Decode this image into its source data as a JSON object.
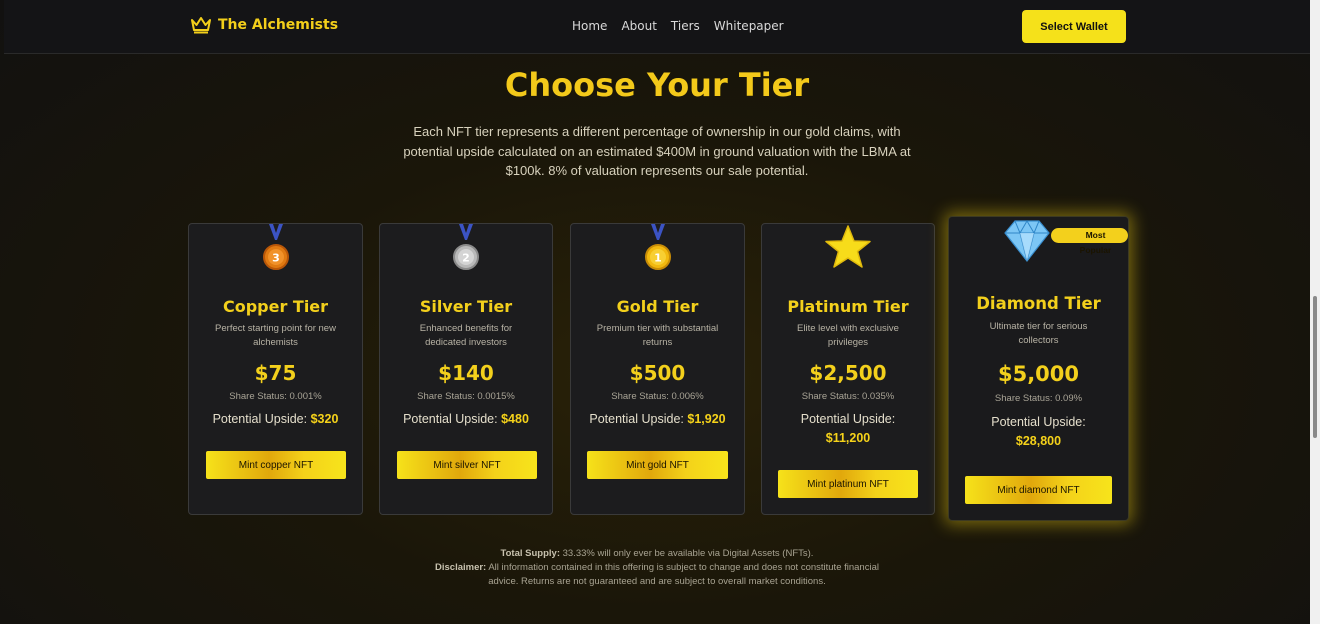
{
  "brand": {
    "name": "The Alchemists",
    "icon": "crown-icon"
  },
  "nav": {
    "links": [
      "Home",
      "About",
      "Tiers",
      "Whitepaper"
    ],
    "wallet_label": "Select Wallet"
  },
  "header": {
    "title": "Choose Your Tier",
    "subtitle": "Each NFT tier represents a different percentage of ownership in our gold claims, with potential upside calculated on an estimated $400M in ground valuation with the LBMA at $100k. 8% of valuation represents our sale potential."
  },
  "tiers": [
    {
      "name": "Copper Tier",
      "icon": "bronze-medal-icon",
      "desc": "Perfect starting point for new alchemists",
      "price": "$75",
      "share": "Share Status: 0.001%",
      "upside_label": "Potential Upside:",
      "upside_value": "$320",
      "button": "Mint copper NFT"
    },
    {
      "name": "Silver Tier",
      "icon": "silver-medal-icon",
      "desc": "Enhanced benefits for dedicated investors",
      "price": "$140",
      "share": "Share Status: 0.0015%",
      "upside_label": "Potential Upside:",
      "upside_value": "$480",
      "button": "Mint silver NFT"
    },
    {
      "name": "Gold Tier",
      "icon": "gold-medal-icon",
      "desc": "Premium tier with substantial returns",
      "price": "$500",
      "share": "Share Status: 0.006%",
      "upside_label": "Potential Upside:",
      "upside_value": "$1,920",
      "button": "Mint gold NFT"
    },
    {
      "name": "Platinum Tier",
      "icon": "star-icon",
      "desc": "Elite level with exclusive privileges",
      "price": "$2,500",
      "share": "Share Status: 0.035%",
      "upside_label": "Potential Upside:",
      "upside_value": "$11,200",
      "button": "Mint platinum NFT"
    },
    {
      "name": "Diamond Tier",
      "icon": "diamond-icon",
      "desc": "Ultimate tier for serious collectors",
      "price": "$5,000",
      "share": "Share Status: 0.09%",
      "upside_label": "Potential Upside:",
      "upside_value": "$28,800",
      "button": "Mint diamond NFT",
      "badge": "Most Popular"
    }
  ],
  "footer": {
    "supply_label": "Total Supply:",
    "supply_text": " 33.33% will only ever be available via Digital Assets (NFTs).",
    "disclaimer_label": "Disclaimer:",
    "disclaimer_text": " All information contained in this offering is subject to change and does not constitute financial advice. Returns are not guaranteed and are subject to overall market conditions."
  },
  "colors": {
    "accent": "#f3d01c",
    "background": "#141416",
    "card": "#1c1c1e"
  }
}
